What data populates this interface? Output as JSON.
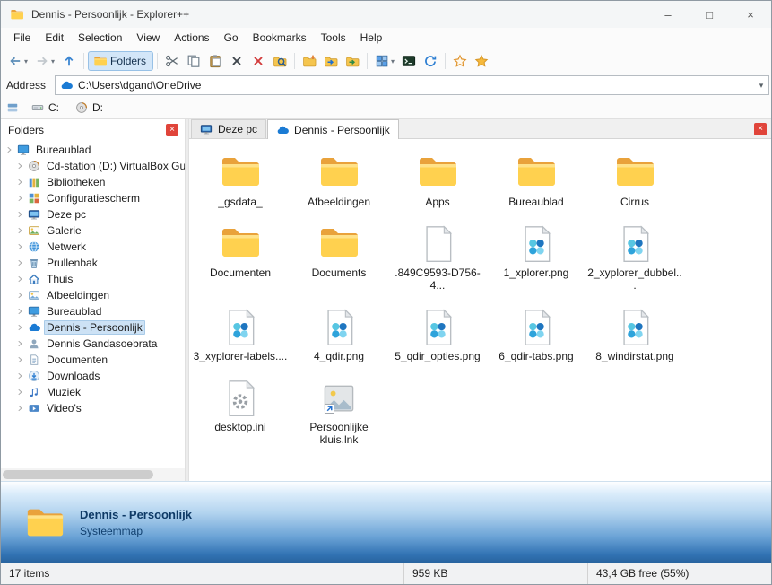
{
  "ui": {
    "close_glyph": "×",
    "caret_glyph": "▾"
  },
  "window": {
    "title": "Dennis - Persoonlijk - Explorer++",
    "controls": {
      "minimize": "–",
      "maximize": "□",
      "close": "×"
    }
  },
  "menu_bar": {
    "items": [
      "File",
      "Edit",
      "Selection",
      "View",
      "Actions",
      "Go",
      "Bookmarks",
      "Tools",
      "Help"
    ]
  },
  "toolbar": {
    "buttons": [
      {
        "name": "back",
        "icon": "arrow-left",
        "dropdown": true
      },
      {
        "name": "forward",
        "icon": "arrow-right",
        "dropdown": true,
        "disabled": true
      },
      {
        "name": "up",
        "icon": "arrow-up"
      },
      {
        "sep": true
      },
      {
        "name": "folders-toggle",
        "icon": "folder",
        "label": "Folders",
        "toggled": true
      },
      {
        "sep": true
      },
      {
        "name": "cut",
        "icon": "scissors"
      },
      {
        "name": "copy",
        "icon": "copy"
      },
      {
        "name": "paste",
        "icon": "paste"
      },
      {
        "name": "delete",
        "icon": "cross"
      },
      {
        "name": "delete-permanently",
        "icon": "cross-red"
      },
      {
        "name": "search",
        "icon": "search-folder"
      },
      {
        "sep": true
      },
      {
        "name": "new-folder",
        "icon": "folder-new"
      },
      {
        "name": "copy-to-folder",
        "icon": "folder-copy"
      },
      {
        "name": "move-to-folder",
        "icon": "folder-move"
      },
      {
        "sep": true
      },
      {
        "name": "views",
        "icon": "views-grid",
        "dropdown": true
      },
      {
        "name": "command-prompt",
        "icon": "terminal"
      },
      {
        "name": "refresh",
        "icon": "refresh"
      },
      {
        "sep": true
      },
      {
        "name": "add-bookmark",
        "icon": "star-outline"
      },
      {
        "name": "bookmarks",
        "icon": "star"
      }
    ]
  },
  "address_bar": {
    "label": "Address",
    "value": "C:\\Users\\dgand\\OneDrive"
  },
  "drive_bar": {
    "drives": [
      {
        "label": "C:",
        "icon": "hdd"
      },
      {
        "label": "D:",
        "icon": "disc"
      }
    ]
  },
  "folders_panel": {
    "title": "Folders",
    "tree": [
      {
        "label": "Bureaublad",
        "icon": "desktop",
        "root": true
      },
      {
        "label": "Cd-station (D:) VirtualBox Gue...",
        "icon": "disc"
      },
      {
        "label": "Bibliotheken",
        "icon": "library"
      },
      {
        "label": "Configuratiescherm",
        "icon": "controlpanel"
      },
      {
        "label": "Deze pc",
        "icon": "computer"
      },
      {
        "label": "Galerie",
        "icon": "gallery"
      },
      {
        "label": "Netwerk",
        "icon": "network"
      },
      {
        "label": "Prullenbak",
        "icon": "recycle"
      },
      {
        "label": "Thuis",
        "icon": "home"
      },
      {
        "label": "Afbeeldingen",
        "icon": "pictures"
      },
      {
        "label": "Bureaublad",
        "icon": "desktop"
      },
      {
        "label": "Dennis - Persoonlijk",
        "icon": "onedrive",
        "selected": true
      },
      {
        "label": "Dennis Gandasoebrata",
        "icon": "user"
      },
      {
        "label": "Documenten",
        "icon": "documents"
      },
      {
        "label": "Downloads",
        "icon": "downloads"
      },
      {
        "label": "Muziek",
        "icon": "music"
      },
      {
        "label": "Video's",
        "icon": "video"
      }
    ]
  },
  "tab_bar": {
    "tabs": [
      {
        "label": "Deze pc",
        "icon": "computer",
        "active": false
      },
      {
        "label": "Dennis - Persoonlijk",
        "icon": "onedrive",
        "active": true
      }
    ]
  },
  "file_list": [
    {
      "name": "_gsdata_",
      "type": "folder"
    },
    {
      "name": "Afbeeldingen",
      "type": "folder"
    },
    {
      "name": "Apps",
      "type": "folder"
    },
    {
      "name": "Bureaublad",
      "type": "folder"
    },
    {
      "name": "Cirrus",
      "type": "folder"
    },
    {
      "name": "Documenten",
      "type": "folder"
    },
    {
      "name": "Documents",
      "type": "folder"
    },
    {
      "name": ".849C9593-D756-4...",
      "type": "file"
    },
    {
      "name": "1_xplorer.png",
      "type": "image"
    },
    {
      "name": "2_xyplorer_dubbel...",
      "type": "image"
    },
    {
      "name": "3_xyplorer-labels....",
      "type": "image"
    },
    {
      "name": "4_qdir.png",
      "type": "image"
    },
    {
      "name": "5_qdir_opties.png",
      "type": "image"
    },
    {
      "name": "6_qdir-tabs.png",
      "type": "image"
    },
    {
      "name": "8_windirstat.png",
      "type": "image"
    },
    {
      "name": "desktop.ini",
      "type": "config"
    },
    {
      "name": "Persoonlijke kluis.lnk",
      "type": "shortcut"
    }
  ],
  "info_panel": {
    "title": "Dennis - Persoonlijk",
    "subtitle": "Systeemmap"
  },
  "status_bar": {
    "items": "17 items",
    "size": "959 KB",
    "free": "43,4 GB free (55%)"
  }
}
